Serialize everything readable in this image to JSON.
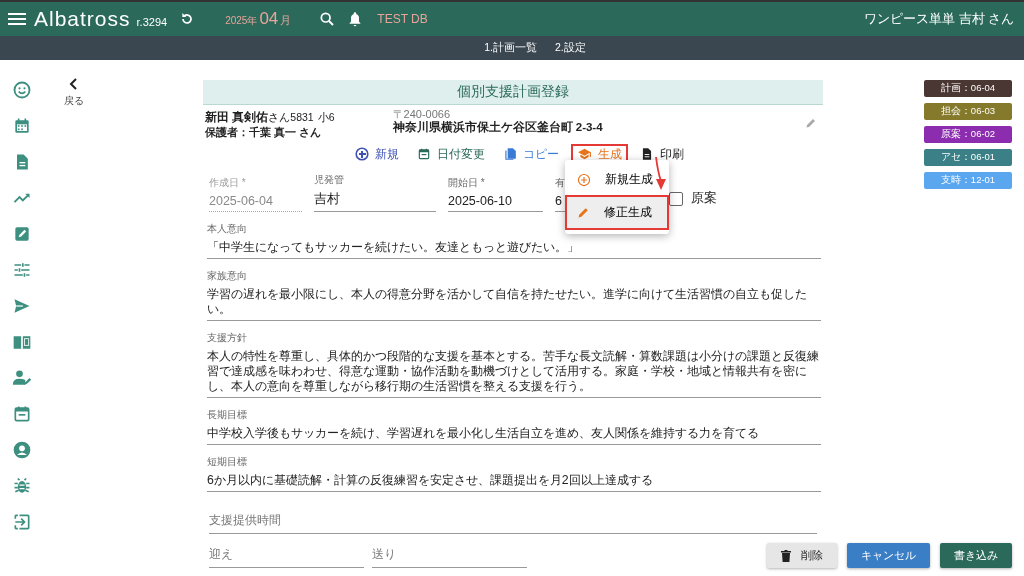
{
  "header": {
    "app_name": "Albatross",
    "revision": "r.3294",
    "year": "2025年",
    "month": "04",
    "month_unit": "月",
    "database": "TEST DB",
    "user": "ワンピース単単 吉村 さん"
  },
  "nav_links": [
    "1.計画一覧",
    "2.設定"
  ],
  "back": {
    "label": "戻る"
  },
  "form": {
    "title": "個別支援計画登録",
    "child": {
      "name": "新田 真剣佑",
      "honorific": "さん",
      "id": "5831",
      "grade": "小6",
      "guardian": "保護者：千葉 真一 さん",
      "postal": "〒240-0066",
      "address": "神奈川県横浜市保土ケ谷区釜台町 2-3-4"
    },
    "toolbar": [
      {
        "kind": "new",
        "label": "新規",
        "color": "#3f51b5",
        "highlighted": false
      },
      {
        "kind": "date",
        "label": "日付変更",
        "color": "#2b6a5a",
        "highlighted": false
      },
      {
        "kind": "copy",
        "label": "コピー",
        "color": "#3a7bd5",
        "highlighted": false
      },
      {
        "kind": "generate",
        "label": "生成",
        "color": "#e8731a",
        "highlighted": true
      },
      {
        "kind": "print",
        "label": "印刷",
        "color": "#222222",
        "highlighted": false
      }
    ],
    "menu": [
      {
        "kind": "add",
        "label": "新規生成",
        "highlighted": false
      },
      {
        "kind": "edit",
        "label": "修正生成",
        "highlighted": true
      }
    ],
    "date_fields": [
      {
        "label": "作成日 *",
        "value": "2025-06-04",
        "disabled": true
      },
      {
        "label": "児発管",
        "value": "吉村",
        "disabled": false
      },
      {
        "label": "開始日 *",
        "value": "2025-06-10",
        "disabled": false
      },
      {
        "label": "有",
        "value": "6",
        "disabled": false
      }
    ],
    "draft": {
      "label": "原案",
      "checked": false
    },
    "text_fields": [
      {
        "label": "本人意向",
        "value": "「中学生になってもサッカーを続けたい。友達ともっと遊びたい。」"
      },
      {
        "label": "家族意向",
        "value": "学習の遅れを最小限にし、本人の得意分野を活かして自信を持たせたい。進学に向けて生活習慣の自立も促したい。"
      },
      {
        "label": "支援方針",
        "value": "本人の特性を尊重し、具体的かつ段階的な支援を基本とする。苦手な長文読解・算数課題は小分けの課題と反復練習で達成感を味わわせ、得意な運動・協作活動を動機づけとして活用する。家庭・学校・地域と情報共有を密にし、本人の意向を尊重しながら移行期の生活習慣を整える支援を行う。"
      },
      {
        "label": "長期目標",
        "value": "中学校入学後もサッカーを続け、学習遅れを最小化し生活自立を進め、友人関係を維持する力を育てる"
      },
      {
        "label": "短期目標",
        "value": "6か月以内に基礎読解・計算の反復練習を安定させ、課題提出を月2回以上達成する"
      }
    ],
    "support_time": {
      "placeholder": "支援提供時間"
    },
    "pickup": {
      "placeholder": "迎え"
    },
    "dropoff": {
      "placeholder": "送り"
    }
  },
  "buttons": [
    {
      "kind": "delete",
      "label": "削除"
    },
    {
      "kind": "cancel",
      "label": "キャンセル"
    },
    {
      "kind": "save",
      "label": "書き込み"
    }
  ],
  "history_tags": [
    {
      "label": "計画：06-04",
      "color": "#4a3633"
    },
    {
      "label": "担会：06-03",
      "color": "#857a2b"
    },
    {
      "label": "原案：06-02",
      "color": "#8c2db0"
    },
    {
      "label": "アセ：06-01",
      "color": "#3a8086"
    },
    {
      "label": "支時：12-01",
      "color": "#5ba7ef"
    }
  ]
}
